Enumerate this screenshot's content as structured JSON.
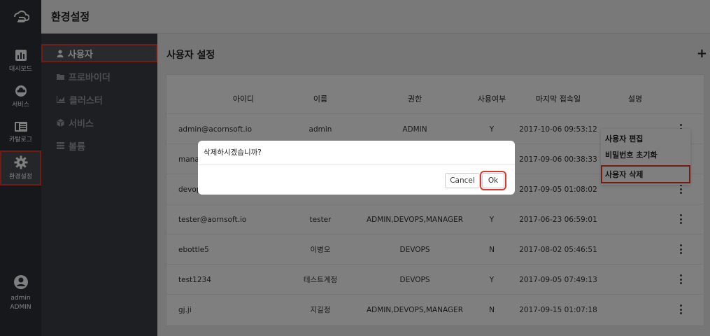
{
  "rail": {
    "items": [
      {
        "label": "대시보드",
        "icon": "bar-chart-icon"
      },
      {
        "label": "서비스",
        "icon": "cloud-icon"
      },
      {
        "label": "카탈로그",
        "icon": "catalog-icon"
      },
      {
        "label": "환경설정",
        "icon": "gear-icon"
      }
    ],
    "user": {
      "name": "admin",
      "role": "ADMIN"
    }
  },
  "header": {
    "title": "환경설정"
  },
  "submenu": {
    "items": [
      {
        "label": "사용자",
        "icon": "user-icon"
      },
      {
        "label": "프로바이더",
        "icon": "folder-icon"
      },
      {
        "label": "클러스터",
        "icon": "area-chart-icon"
      },
      {
        "label": "서비스",
        "icon": "cube-icon"
      },
      {
        "label": "볼륨",
        "icon": "list-icon"
      }
    ]
  },
  "main": {
    "title": "사용자 설정",
    "add_label": "+"
  },
  "table": {
    "headers": [
      "아이디",
      "이름",
      "권한",
      "사용여부",
      "마지막 접속일",
      "설명"
    ],
    "rows": [
      {
        "id": "admin@acornsoft.io",
        "name": "admin",
        "role": "ADMIN",
        "active": "Y",
        "last": "2017-10-06 09:53:12"
      },
      {
        "id": "mana",
        "name": "",
        "role": "",
        "active": "",
        "last": "2017-09-06 00:38:33"
      },
      {
        "id": "devop",
        "name": "",
        "role": "",
        "active": "",
        "last": "2017-09-05 01:08:02"
      },
      {
        "id": "tester@aornsoft.io",
        "name": "tester",
        "role": "ADMIN,DEVOPS,MANAGER",
        "active": "Y",
        "last": "2017-06-23 06:59:01"
      },
      {
        "id": "ebottle5",
        "name": "이병오",
        "role": "DEVOPS",
        "active": "N",
        "last": "2017-08-02 05:46:51"
      },
      {
        "id": "test1234",
        "name": "테스트계정",
        "role": "DEVOPS",
        "active": "Y",
        "last": "2017-09-05 07:49:13"
      },
      {
        "id": "gj.ji",
        "name": "지길정",
        "role": "ADMIN,DEVOPS,MANAGER",
        "active": "N",
        "last": "2017-09-15 01:07:18"
      }
    ]
  },
  "context_menu": {
    "items": [
      "사용자 편집",
      "비밀번호 초기화",
      "사용자 삭제"
    ]
  },
  "dialog": {
    "message": "삭제하시겠습니까?",
    "cancel_label": "Cancel",
    "ok_label": "Ok"
  },
  "colors": {
    "highlight": "#e2382b",
    "rail": "#2d3136",
    "submenu": "#3c3f44"
  }
}
